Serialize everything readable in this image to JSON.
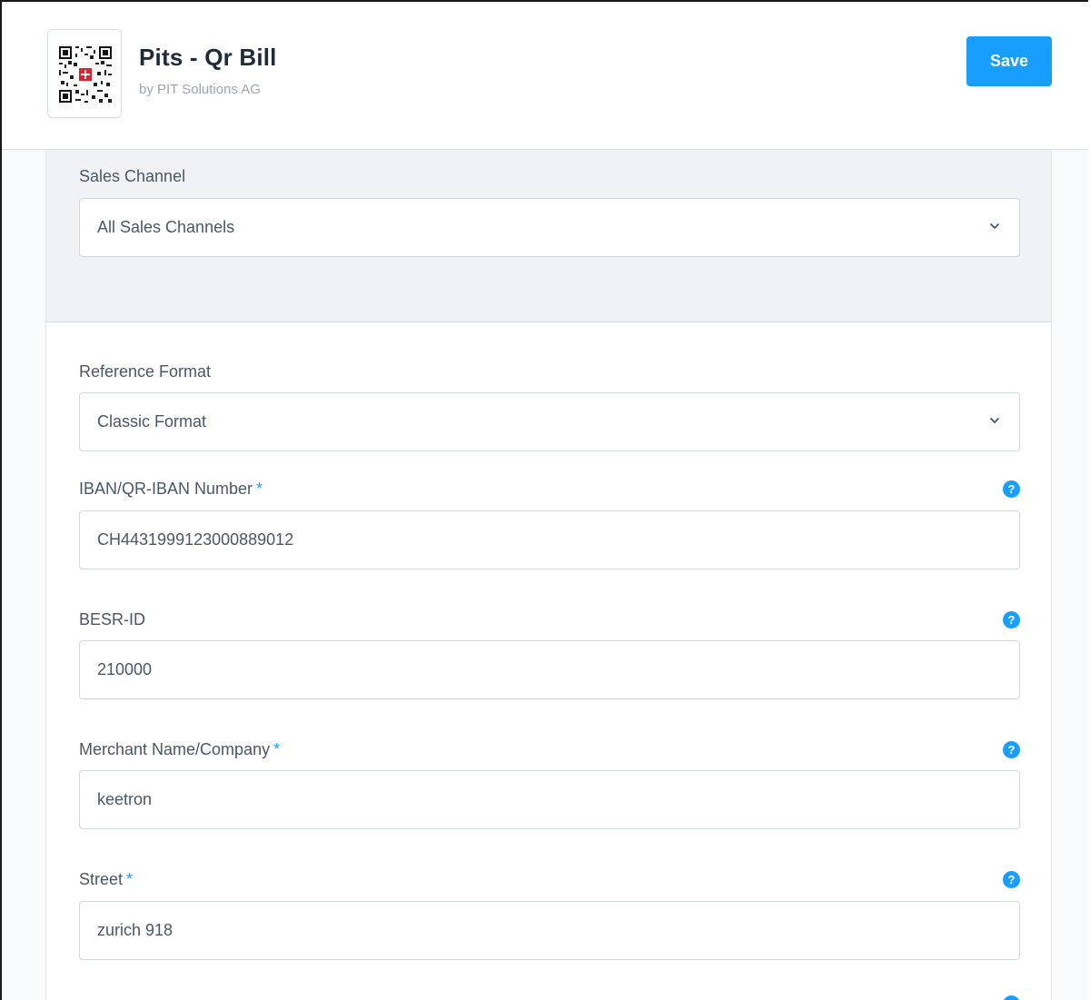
{
  "app": {
    "title": "Pits - Qr Bill",
    "subtitle": "by PIT Solutions AG",
    "save_label": "Save",
    "accent_color": "#189eff"
  },
  "sales_channel": {
    "label": "Sales Channel",
    "value": "All Sales Channels"
  },
  "form": {
    "reference_format": {
      "label": "Reference Format",
      "value": "Classic Format"
    },
    "iban": {
      "label": "IBAN/QR-IBAN Number",
      "required_mark": "*",
      "value": "CH4431999123000889012",
      "help": "?"
    },
    "besr_id": {
      "label": "BESR-ID",
      "value": "210000",
      "help": "?"
    },
    "merchant": {
      "label": "Merchant Name/Company",
      "required_mark": "*",
      "value": "keetron",
      "help": "?"
    },
    "street": {
      "label": "Street",
      "required_mark": "*",
      "value": "zurich 918",
      "help": "?"
    }
  }
}
